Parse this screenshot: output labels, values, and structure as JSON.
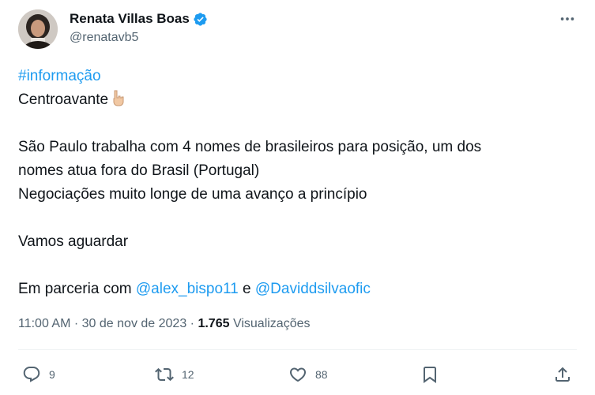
{
  "author": {
    "display_name": "Renata Villas Boas",
    "handle": "@renatavb5",
    "verified_icon": "verified-badge-icon",
    "accent_color": "#1d9bf0"
  },
  "tweet": {
    "hashtag": "#informação",
    "line1": "Centroavante",
    "line1_emoji": "pointing-down-icon",
    "line2": "São Paulo trabalha com 4 nomes de brasileiros para posição, um dos",
    "line3": "nomes atua fora do Brasil (Portugal)",
    "line4": "Negociações muito longe de uma avanço a princípio",
    "line5": "Vamos aguardar",
    "partnership_prefix": "Em parceria com",
    "mention1": "@alex_bispo11",
    "conjunction": "e",
    "mention2": "@Daviddsilvaofic"
  },
  "meta": {
    "time": "11:00 AM",
    "separator": "·",
    "date": "30 de nov de 2023",
    "views_count": "1.765",
    "views_label": "Visualizações"
  },
  "actions": {
    "replies": "9",
    "retweets": "12",
    "likes": "88"
  },
  "colors": {
    "text": "#0f1419",
    "secondary": "#536471",
    "link": "#1d9bf0",
    "divider": "#eff3f4"
  }
}
